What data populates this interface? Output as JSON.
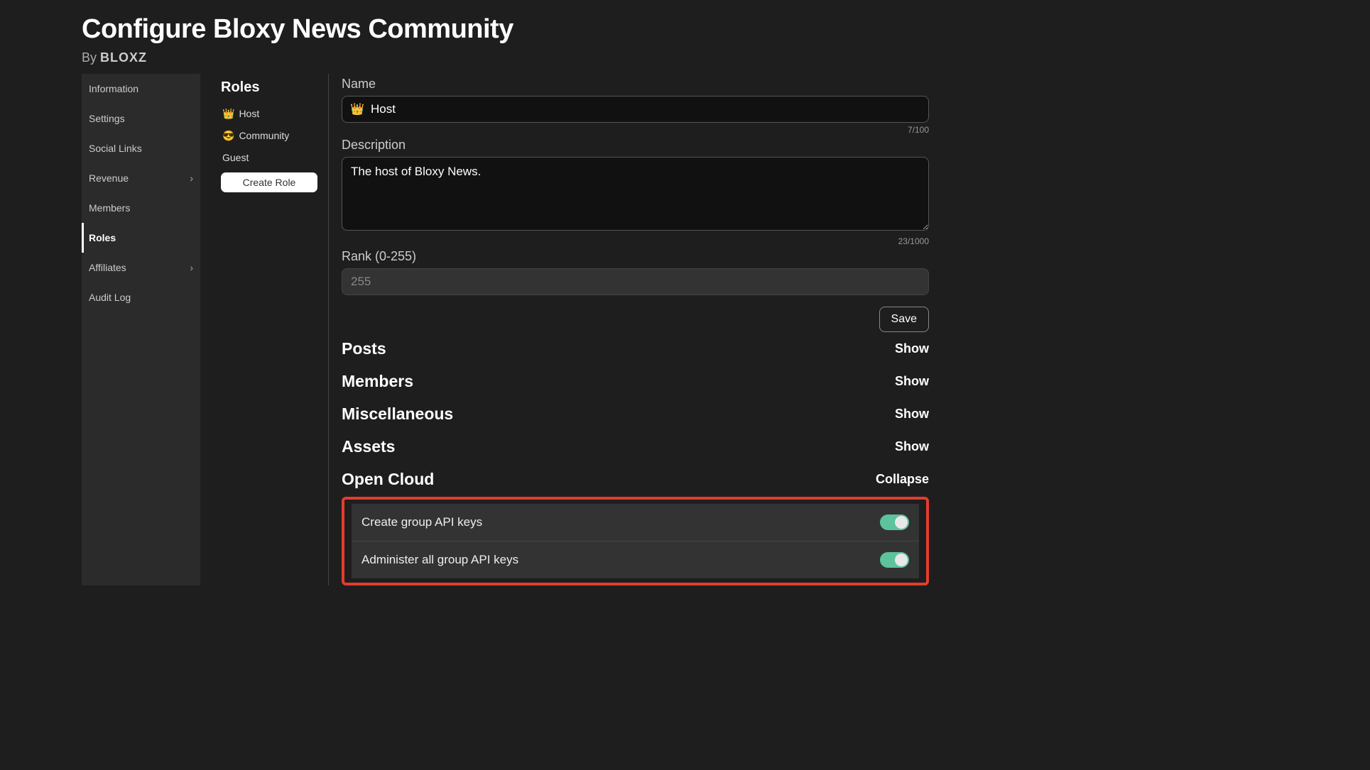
{
  "header": {
    "title": "Configure Bloxy News Community",
    "by_label": "By",
    "author": "BLOXZ"
  },
  "sidebar": {
    "items": [
      {
        "label": "Information",
        "has_chevron": false
      },
      {
        "label": "Settings",
        "has_chevron": false
      },
      {
        "label": "Social Links",
        "has_chevron": false
      },
      {
        "label": "Revenue",
        "has_chevron": true
      },
      {
        "label": "Members",
        "has_chevron": false
      },
      {
        "label": "Roles",
        "has_chevron": false,
        "active": true
      },
      {
        "label": "Affiliates",
        "has_chevron": true
      },
      {
        "label": "Audit Log",
        "has_chevron": false
      }
    ]
  },
  "roles_panel": {
    "header": "Roles",
    "items": [
      {
        "emoji": "👑",
        "label": "Host"
      },
      {
        "emoji": "😎",
        "label": "Community"
      },
      {
        "emoji": "",
        "label": "Guest"
      }
    ],
    "create_button": "Create Role"
  },
  "form": {
    "name_label": "Name",
    "name_icon": "👑",
    "name_value": "Host",
    "name_count": "7/100",
    "description_label": "Description",
    "description_value": "The host of Bloxy News.",
    "description_count": "23/1000",
    "rank_label": "Rank (0-255)",
    "rank_value": "255",
    "save_button": "Save"
  },
  "sections": [
    {
      "title": "Posts",
      "toggle": "Show"
    },
    {
      "title": "Members",
      "toggle": "Show"
    },
    {
      "title": "Miscellaneous",
      "toggle": "Show"
    },
    {
      "title": "Assets",
      "toggle": "Show"
    },
    {
      "title": "Open Cloud",
      "toggle": "Collapse"
    }
  ],
  "open_cloud_permissions": [
    {
      "label": "Create group API keys",
      "enabled": true
    },
    {
      "label": "Administer all group API keys",
      "enabled": true
    }
  ]
}
